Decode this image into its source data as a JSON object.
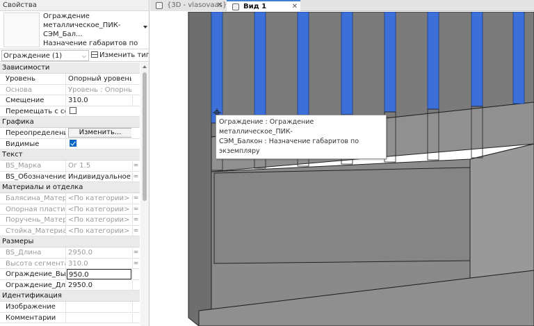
{
  "properties": {
    "title": "Свойства",
    "type_selector": {
      "name": "Ограждение\nметаллическое_ПИК-СЭМ_Бал...\nНазначение габаритов по\nэкземпляру"
    },
    "instance_filter": "Ограждение (1)",
    "edit_type_label": "Изменить тип",
    "groups": {
      "constraints": {
        "title": "Зависимости",
        "level_key": "Уровень",
        "level_val": "Опорный уровень",
        "host_key": "Основа",
        "host_val": "Уровень : Опорны...",
        "offset_key": "Смещение",
        "offset_val": "310.0",
        "move_key": "Перемещать с со..."
      },
      "graphics": {
        "title": "Графика",
        "override_key": "Переопределени...",
        "override_btn": "Изменить...",
        "visible_key": "Видимые"
      },
      "text": {
        "title": "Текст",
        "mark_key": "BS_Марка",
        "mark_val": "Ог 1.5",
        "designation_key": "BS_Обозначение",
        "designation_val": "Индивидуальное и..."
      },
      "materials": {
        "title": "Материалы и отделка",
        "baluster_key": "Балясина_Матер...",
        "baluster_val": "<По категории>",
        "plate_key": "Опорная пластин...",
        "plate_val": "<По категории>",
        "rail_key": "Поручень_Матер...",
        "rail_val": "<По категории>",
        "post_key": "Стойка_Материал",
        "post_val": "<По категории>"
      },
      "dimensions": {
        "title": "Размеры",
        "length_key": "BS_Длина",
        "length_val": "2950.0",
        "seg_height_key": "Высота сегмента ...",
        "seg_height_val": "310.0",
        "rail_height_key": "Ограждение_Выс...",
        "rail_height_val": "950.0",
        "rail_length_key": "Ограждение_Дли...",
        "rail_length_val": "2950.0"
      },
      "identity": {
        "title": "Идентификация",
        "image_key": "Изображение",
        "comments_key": "Комментарии"
      }
    }
  },
  "tabs": [
    {
      "label": "{3D - vlasovaas}",
      "active": false
    },
    {
      "label": "Вид 1",
      "active": true
    }
  ],
  "viewport": {
    "tooltip": "Ограждение : Ограждение металлическое_ПИК-\nСЭМ_Балкон : Назначение габаритов по экземпляру",
    "colors": {
      "highlight": "#3d6fd8",
      "surface": "#8c8c8c",
      "surface_dark": "#7a7a7a",
      "edge": "#222222"
    }
  }
}
